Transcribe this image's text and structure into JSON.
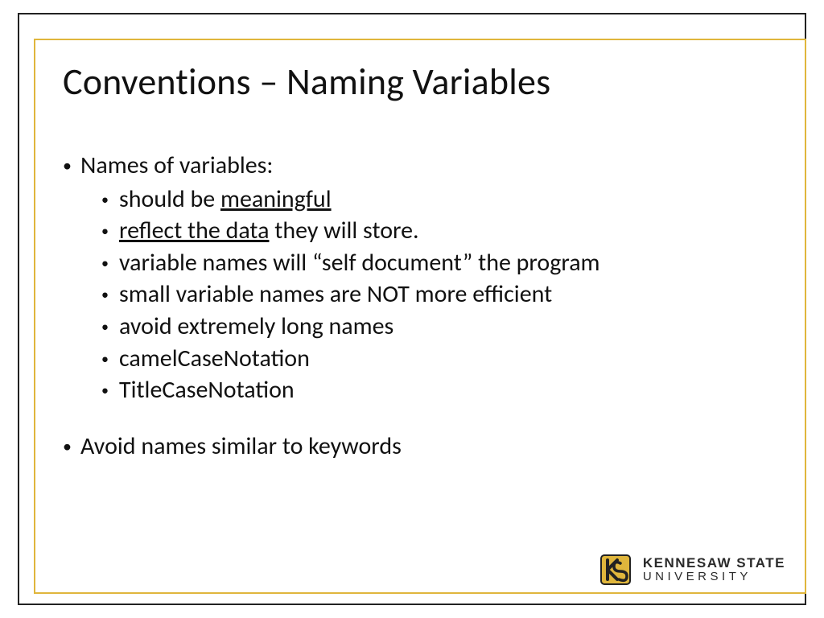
{
  "title": "Conventions – Naming Variables",
  "bullets": {
    "top1": "Names of variables:",
    "sub": {
      "s1a": "should be ",
      "s1b": "meaningful",
      "s2a": "reflect the data",
      "s2b": " they will store.",
      "s3": "variable names will “self document” the program",
      "s4": "small variable names are NOT more efficient",
      "s5": "avoid extremely long names",
      "s6": "camelCaseNotation",
      "s7": "TitleCaseNotation"
    },
    "top2": "Avoid names similar to keywords"
  },
  "logo": {
    "line1": "KENNESAW STATE",
    "line2": "UNIVERSITY"
  },
  "colors": {
    "gold": "#e0b63c",
    "ink": "#222222"
  }
}
